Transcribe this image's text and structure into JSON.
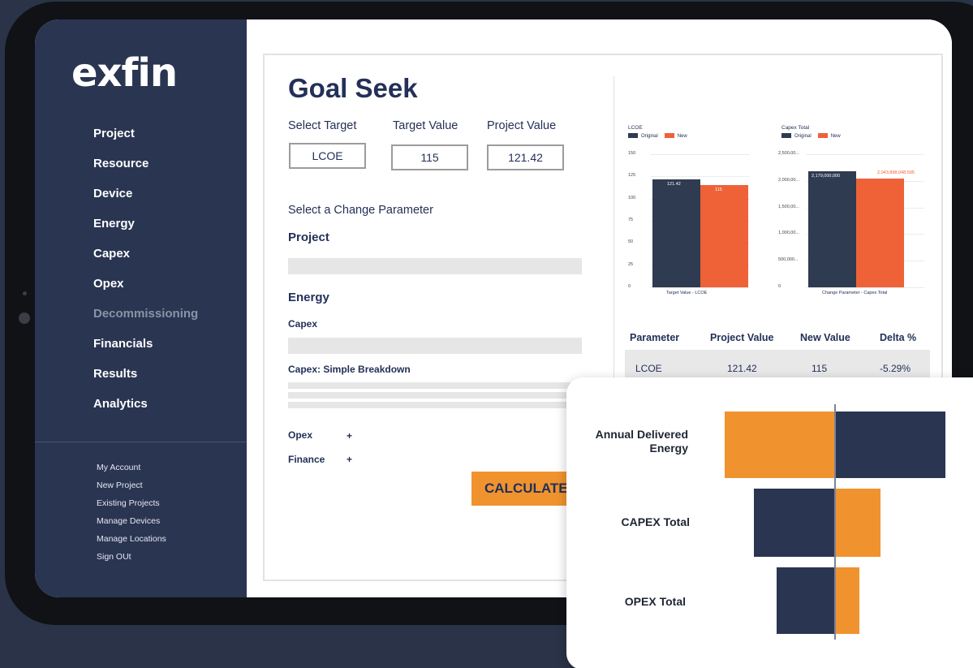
{
  "app": {
    "logo": "exfin"
  },
  "sidebar": {
    "items": [
      {
        "label": "Project"
      },
      {
        "label": "Resource"
      },
      {
        "label": "Device"
      },
      {
        "label": "Energy"
      },
      {
        "label": "Capex"
      },
      {
        "label": "Opex"
      },
      {
        "label": "Decommissioning"
      },
      {
        "label": "Financials"
      },
      {
        "label": "Results"
      },
      {
        "label": "Analytics"
      }
    ],
    "secondary": [
      {
        "label": "My Account"
      },
      {
        "label": "New Project"
      },
      {
        "label": "Existing Projects"
      },
      {
        "label": "Manage Devices"
      },
      {
        "label": "Manage Locations"
      },
      {
        "label": "Sign OUt"
      }
    ]
  },
  "goal_seek": {
    "title": "Goal Seek",
    "select_target_label": "Select Target",
    "target_value_label": "Target Value",
    "project_value_label": "Project Value",
    "select_target_value": "LCOE",
    "target_value": "115",
    "project_value": "121.42",
    "change_param_label": "Select a Change Parameter",
    "sections": {
      "project": "Project",
      "energy": "Energy",
      "capex": "Capex",
      "capex_breakdown": "Capex: Simple Breakdown",
      "opex": "Opex",
      "finance": "Finance",
      "plus": "+"
    },
    "calculate_label": "CALCULATE"
  },
  "chart_data": [
    {
      "type": "bar",
      "title": "LCOE",
      "series": [
        {
          "name": "Original",
          "values": [
            121.42
          ]
        },
        {
          "name": "New",
          "values": [
            115
          ]
        }
      ],
      "categories": [
        "Target Value - LCOE"
      ],
      "yticks": [
        "150",
        "125",
        "100",
        "75",
        "50",
        "25",
        "0"
      ],
      "ylim": [
        0,
        150
      ],
      "data_labels": [
        "121.42",
        "115"
      ]
    },
    {
      "type": "bar",
      "title": "Capex Total",
      "series": [
        {
          "name": "Original",
          "values": [
            2179000000
          ]
        },
        {
          "name": "New",
          "values": [
            2043000000
          ]
        }
      ],
      "categories": [
        "Change Parameter - Capex Total"
      ],
      "yticks": [
        "2,500,00...",
        "2,000,00...",
        "1,500,00...",
        "1,000,00...",
        "500,000...",
        "0"
      ],
      "ylim": [
        0,
        2500000000
      ],
      "data_labels": [
        "2,179,000,000",
        "2,043,898,048.595"
      ]
    }
  ],
  "colors": {
    "original": "#2f3b50",
    "new": "#ef6137",
    "navy": "#2a3552",
    "orange": "#f0932e"
  },
  "results_table": {
    "headers": [
      "Parameter",
      "Project Value",
      "New Value",
      "Delta %"
    ],
    "rows": [
      [
        "LCOE",
        "121.42",
        "115",
        "-5.29%"
      ]
    ]
  },
  "tornado": {
    "labels": [
      "Annual Delivered\nEnergy",
      "CAPEX Total",
      "OPEX Total"
    ],
    "bars": [
      {
        "low": -136,
        "high": 136
      },
      {
        "low": -100,
        "high": 56
      },
      {
        "low": -72,
        "high": 30
      }
    ]
  }
}
